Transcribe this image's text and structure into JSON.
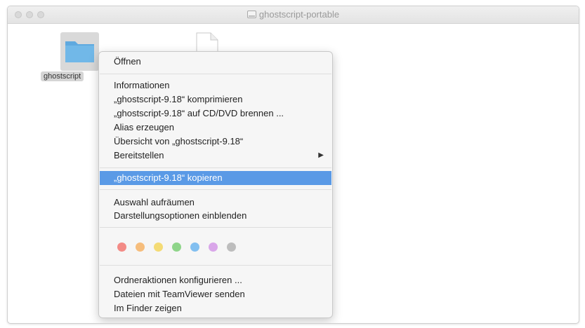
{
  "window": {
    "title": "ghostscript-portable"
  },
  "desktop": {
    "folder_label": "ghostscript"
  },
  "context_menu": {
    "open": "Öffnen",
    "info": "Informationen",
    "compress": "„ghostscript-9.18“ komprimieren",
    "burn": "„ghostscript-9.18“ auf CD/DVD brennen ...",
    "alias": "Alias erzeugen",
    "quicklook": "Übersicht von „ghostscript-9.18“",
    "share": "Bereitstellen",
    "share_arrow": "▶",
    "copy": "„ghostscript-9.18“ kopieren",
    "cleanup": "Auswahl aufräumen",
    "view_options": "Darstellungsoptionen einblenden",
    "folder_actions": "Ordneraktionen konfigurieren ...",
    "teamviewer": "Dateien mit TeamViewer senden",
    "show_in_finder": "Im Finder zeigen"
  },
  "tags": [
    {
      "name": "red",
      "color": "#f38b86"
    },
    {
      "name": "orange",
      "color": "#f6bd7c"
    },
    {
      "name": "yellow",
      "color": "#f4db75"
    },
    {
      "name": "green",
      "color": "#8fd58a"
    },
    {
      "name": "blue",
      "color": "#82bff0"
    },
    {
      "name": "purple",
      "color": "#d9a6e9"
    },
    {
      "name": "gray",
      "color": "#bdbdbd"
    }
  ]
}
